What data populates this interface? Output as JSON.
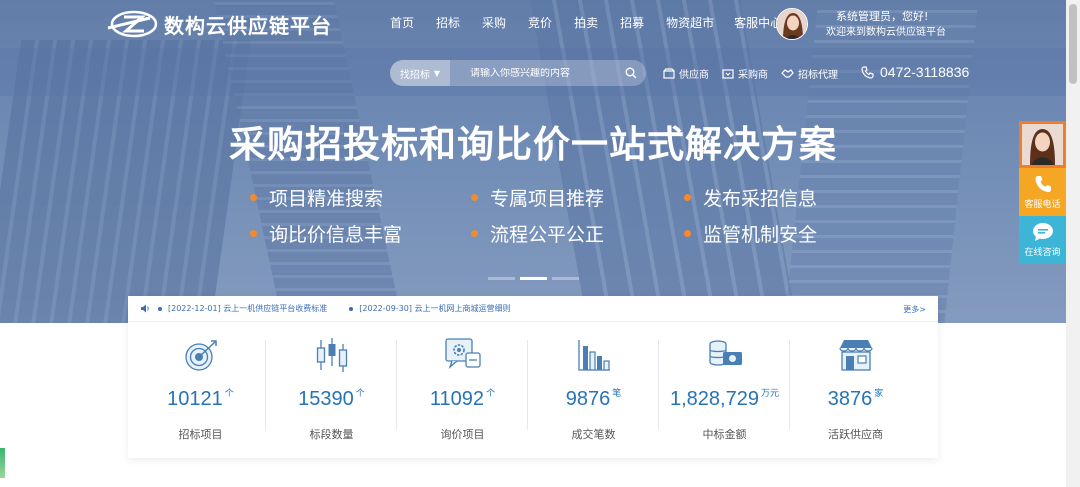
{
  "brand": {
    "name": "数构云供应链平台"
  },
  "nav": [
    "首页",
    "招标",
    "采购",
    "竞价",
    "拍卖",
    "招募",
    "物资超市",
    "客服中心"
  ],
  "user": {
    "greeting": "系统管理员，您好!",
    "welcome": "欢迎来到数构云供应链平台"
  },
  "search": {
    "category": "找招标",
    "placeholder": "请输入你感兴趣的内容"
  },
  "quick_links": [
    "供应商",
    "采购商",
    "招标代理"
  ],
  "phone": "0472-3118836",
  "hero": {
    "title": "采购招投标和询比价一站式解决方案",
    "features": [
      "项目精准搜索",
      "专属项目推荐",
      "发布采招信息",
      "询比价信息丰富",
      "流程公平公正",
      "监管机制安全"
    ]
  },
  "side_tools": {
    "phone_label": "客服电话",
    "chat_label": "在线咨询"
  },
  "notices": {
    "items": [
      "[2022-12-01] 云上一机供应链平台收费标准",
      "[2022-09-30] 云上一机网上商城运营细则"
    ],
    "more": "更多>"
  },
  "stats": [
    {
      "icon": "target-icon",
      "value": "10121",
      "unit": "个",
      "label": "招标项目"
    },
    {
      "icon": "candlestick-icon",
      "value": "15390",
      "unit": "个",
      "label": "标段数量"
    },
    {
      "icon": "inquiry-icon",
      "value": "11092",
      "unit": "个",
      "label": "询价项目"
    },
    {
      "icon": "bar-chart-icon",
      "value": "9876",
      "unit": "笔",
      "label": "成交笔数"
    },
    {
      "icon": "coins-icon",
      "value": "1,828,729",
      "unit": "万元",
      "label": "中标金额"
    },
    {
      "icon": "store-icon",
      "value": "3876",
      "unit": "家",
      "label": "活跃供应商"
    }
  ],
  "colors": {
    "accent": "#2773b7",
    "orange": "#f28a2e",
    "phone_btn": "#f5a623",
    "chat_btn": "#3db5d6"
  }
}
